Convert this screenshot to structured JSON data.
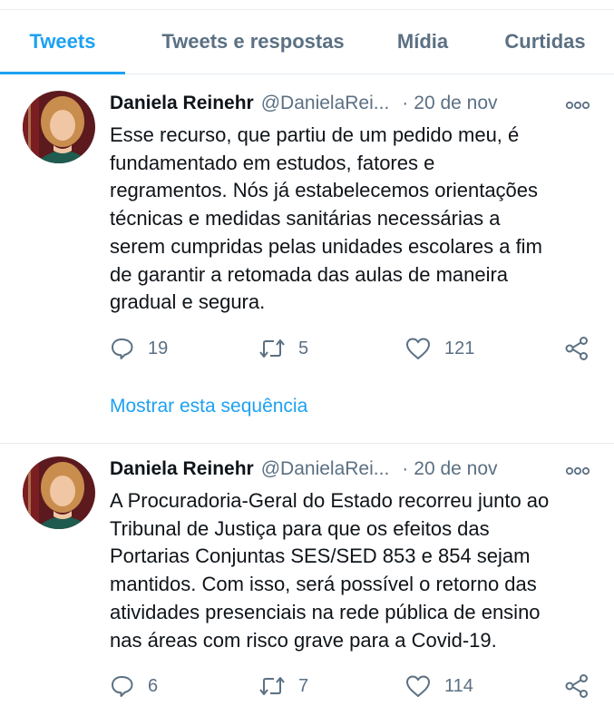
{
  "tabs": [
    {
      "label": "Tweets",
      "active": true
    },
    {
      "label": "Tweets e respostas",
      "active": false
    },
    {
      "label": "Mídia",
      "active": false
    },
    {
      "label": "Curtidas",
      "active": false
    }
  ],
  "tweets": [
    {
      "author": "Daniela Reinehr",
      "handle": "@DanielaRei...",
      "separator": "·",
      "date": "20 de nov",
      "text_lines": [
        "Esse recurso, que partiu de um pedido meu, é",
        "fundamentado em estudos, fatores e",
        "regramentos. Nós já estabelecemos orientações",
        "técnicas e medidas sanitárias necessárias a",
        "serem cumpridas pelas unidades escolares a fim",
        "de garantir a retomada das aulas de maneira",
        "gradual e segura."
      ],
      "replies": "19",
      "retweets": "5",
      "likes": "121",
      "show_thread": "Mostrar esta sequência"
    },
    {
      "author": "Daniela Reinehr",
      "handle": "@DanielaRei...",
      "separator": "·",
      "date": "20 de nov",
      "text_lines": [
        "A Procuradoria-Geral do Estado recorreu junto ao",
        "Tribunal de Justiça para que os efeitos das",
        "Portarias Conjuntas SES/SED 853 e 854 sejam",
        "mantidos. Com isso, será possível o retorno das",
        "atividades presenciais na rede pública de ensino",
        "nas áreas com risco grave para a Covid-19."
      ],
      "replies": "6",
      "retweets": "7",
      "likes": "114"
    }
  ],
  "icons": {
    "reply": "speech-bubble-icon",
    "retweet": "retweet-arrows-icon",
    "like": "heart-icon",
    "share": "share-nodes-icon",
    "more": "more-dots-icon"
  },
  "colors": {
    "accent": "#1da1f2",
    "secondary_text": "#5b7083",
    "divider": "#e6ecf0"
  }
}
